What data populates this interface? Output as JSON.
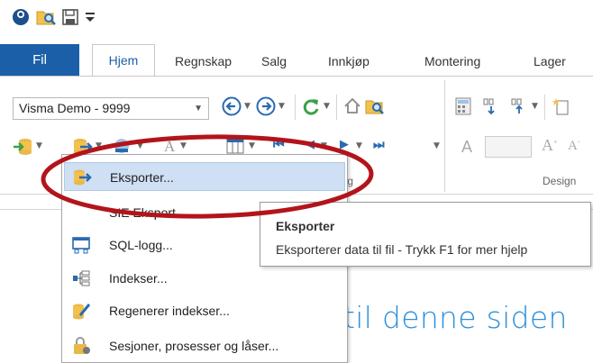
{
  "tabs": {
    "fil": "Fil",
    "items": [
      "Hjem",
      "Regnskap",
      "Salg",
      "Innkjøp",
      "Montering",
      "Lager"
    ]
  },
  "ribbon": {
    "company_value": "Visma Demo - 9999",
    "group_labels": [
      "ing",
      "Design"
    ]
  },
  "menu": {
    "items": [
      {
        "label": "Eksporter...",
        "icon": "export-arrow-icon",
        "highlighted": true
      },
      {
        "label": "SIE Eksport...",
        "icon": "",
        "highlighted": false
      },
      {
        "label": "SQL-logg...",
        "icon": "sql-log-icon",
        "highlighted": false
      },
      {
        "label": "Indekser...",
        "icon": "index-icon",
        "highlighted": false
      },
      {
        "label": "Regenerer indekser...",
        "icon": "regenerate-index-icon",
        "highlighted": false
      },
      {
        "label": "Sesjoner, prosesser og låser...",
        "icon": "sessions-lock-icon",
        "highlighted": false
      }
    ]
  },
  "tooltip": {
    "title": "Eksporter",
    "description": "Eksporterer data til fil - Trykk F1 for mer hjelp"
  },
  "page": {
    "partial_heading": "til denne siden"
  },
  "colors": {
    "accent": "#1a5fa8",
    "heading": "#2b8fd8",
    "highlight": "#cfe0f4",
    "annotation": "#b3141b"
  }
}
